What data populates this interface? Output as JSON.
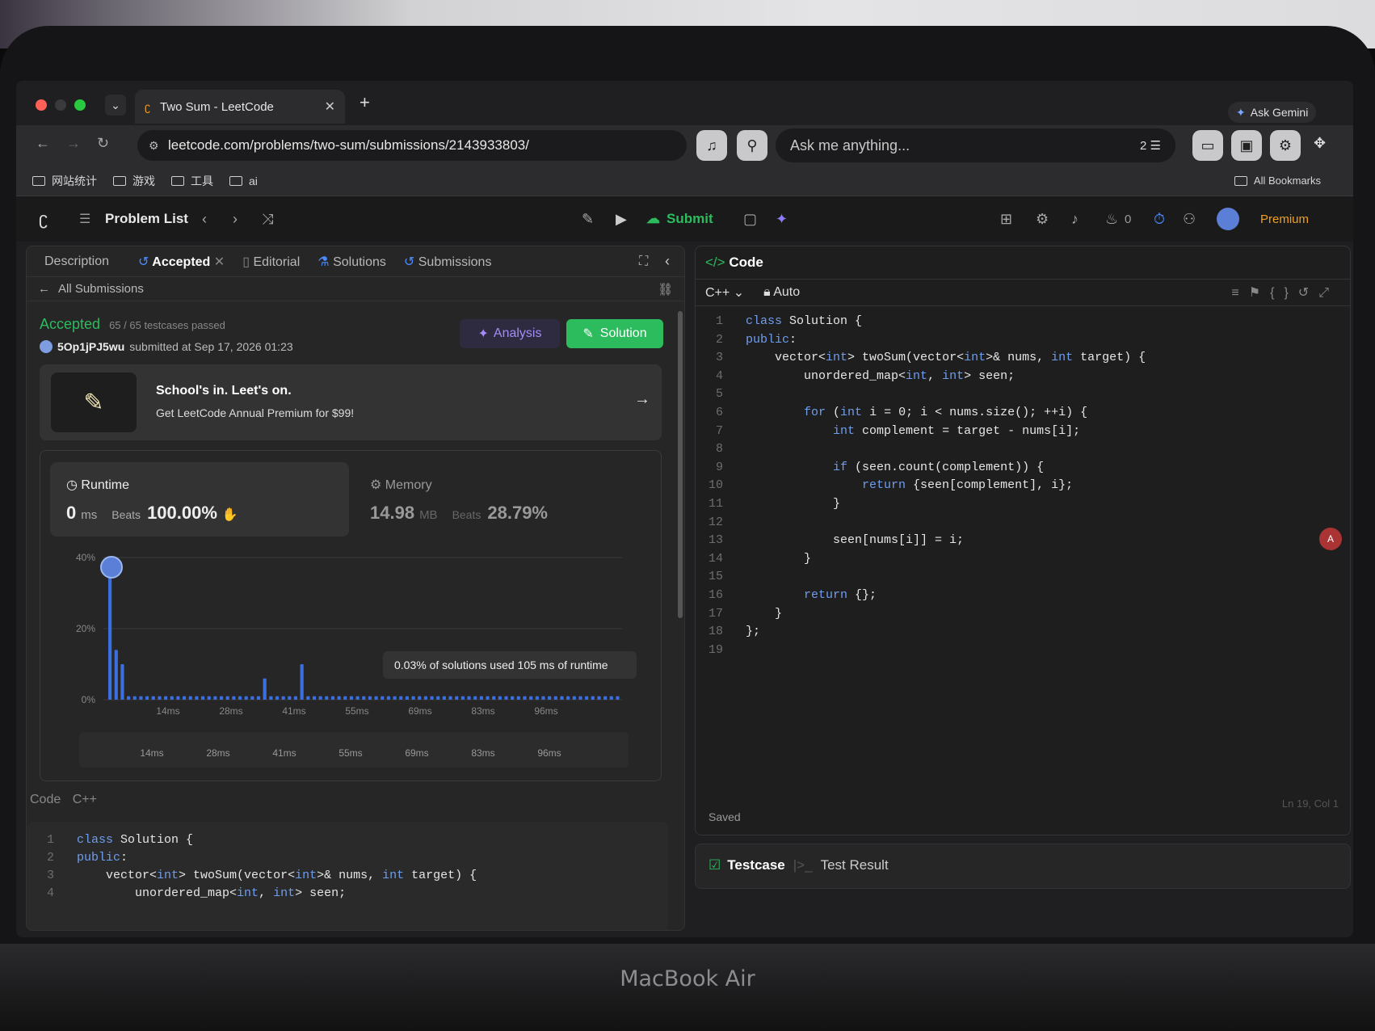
{
  "browser": {
    "tab_title": "Two Sum - LeetCode",
    "url": "leetcode.com/problems/two-sum/submissions/2143933803/",
    "ask_placeholder": "Ask me anything...",
    "ask_gemini": "Ask Gemini",
    "notif_count": "2",
    "bookmarks": [
      "网站统计",
      "游戏",
      "工具",
      "ai"
    ],
    "all_bookmarks": "All Bookmarks"
  },
  "lc_header": {
    "problem_list": "Problem List",
    "submit": "Submit",
    "streak": "0",
    "premium": "Premium"
  },
  "left_tabs": {
    "description": "Description",
    "accepted": "Accepted",
    "editorial": "Editorial",
    "solutions": "Solutions",
    "submissions": "Submissions"
  },
  "all_submissions": "All Submissions",
  "result": {
    "status": "Accepted",
    "testcases": "65 / 65 testcases passed",
    "user": "5Op1jPJ5wu",
    "submitted": "submitted at Sep 17, 2026 01:23",
    "analysis": "Analysis",
    "solution": "Solution"
  },
  "promo": {
    "title": "School's in. Leet's on.",
    "subtitle": "Get LeetCode Annual Premium for $99!"
  },
  "runtime": {
    "label": "Runtime",
    "value": "0",
    "unit": "ms",
    "beats_label": "Beats",
    "beats": "100.00%"
  },
  "memory": {
    "label": "Memory",
    "value": "14.98",
    "unit": "MB",
    "beats_label": "Beats",
    "beats": "28.79%"
  },
  "chart_data": {
    "type": "bar",
    "y_ticks": [
      "40%",
      "20%",
      "0%"
    ],
    "x_ticks": [
      "14ms",
      "28ms",
      "41ms",
      "55ms",
      "69ms",
      "83ms",
      "96ms"
    ],
    "ylim": [
      0,
      40
    ],
    "values": [
      38,
      14,
      10,
      1,
      1,
      1,
      1,
      1,
      1,
      1,
      1,
      1,
      1,
      1,
      1,
      1,
      1,
      1,
      1,
      1,
      1,
      1,
      1,
      1,
      1,
      6,
      1,
      1,
      1,
      1,
      1,
      10,
      1,
      1,
      1,
      1,
      1,
      1,
      1,
      1,
      1,
      1,
      1,
      1,
      1,
      1,
      1,
      1,
      1,
      1,
      1,
      1,
      1,
      1,
      1,
      1,
      1,
      1,
      1,
      1,
      1,
      1,
      1,
      1,
      1,
      1,
      1,
      1,
      1,
      1,
      1,
      1,
      1,
      1,
      1,
      1,
      1,
      1,
      1,
      1,
      1,
      1,
      1
    ],
    "tooltip": "0.03% of solutions used 105 ms of runtime",
    "colors": {
      "bar": "#3b6fe0"
    }
  },
  "bottom_code": {
    "label": "Code",
    "lang": "C++",
    "lines": [
      {
        "n": "1",
        "t": "class Solution {"
      },
      {
        "n": "2",
        "t": "public:"
      },
      {
        "n": "3",
        "t": "    vector<int> twoSum(vector<int>& nums, int target) {"
      },
      {
        "n": "4",
        "t": "        unordered_map<int, int> seen;"
      }
    ]
  },
  "editor": {
    "title": "Code",
    "lang": "C++",
    "mode": "Auto",
    "saved": "Saved",
    "cursor": "Ln 19, Col 1",
    "lines": [
      {
        "n": "1",
        "t": "class Solution {"
      },
      {
        "n": "2",
        "t": "public:"
      },
      {
        "n": "3",
        "t": "    vector<int> twoSum(vector<int>& nums, int target) {"
      },
      {
        "n": "4",
        "t": "        unordered_map<int, int> seen;"
      },
      {
        "n": "5",
        "t": ""
      },
      {
        "n": "6",
        "t": "        for (int i = 0; i < nums.size(); ++i) {"
      },
      {
        "n": "7",
        "t": "            int complement = target - nums[i];"
      },
      {
        "n": "8",
        "t": ""
      },
      {
        "n": "9",
        "t": "            if (seen.count(complement)) {"
      },
      {
        "n": "10",
        "t": "                return {seen[complement], i};"
      },
      {
        "n": "11",
        "t": "            }"
      },
      {
        "n": "12",
        "t": ""
      },
      {
        "n": "13",
        "t": "            seen[nums[i]] = i;"
      },
      {
        "n": "14",
        "t": "        }"
      },
      {
        "n": "15",
        "t": ""
      },
      {
        "n": "16",
        "t": "        return {};"
      },
      {
        "n": "17",
        "t": "    }"
      },
      {
        "n": "18",
        "t": "};"
      },
      {
        "n": "19",
        "t": ""
      }
    ]
  },
  "bottom_tabs": {
    "testcase": "Testcase",
    "test_result": "Test Result"
  },
  "laptop_brand": "MacBook Air"
}
